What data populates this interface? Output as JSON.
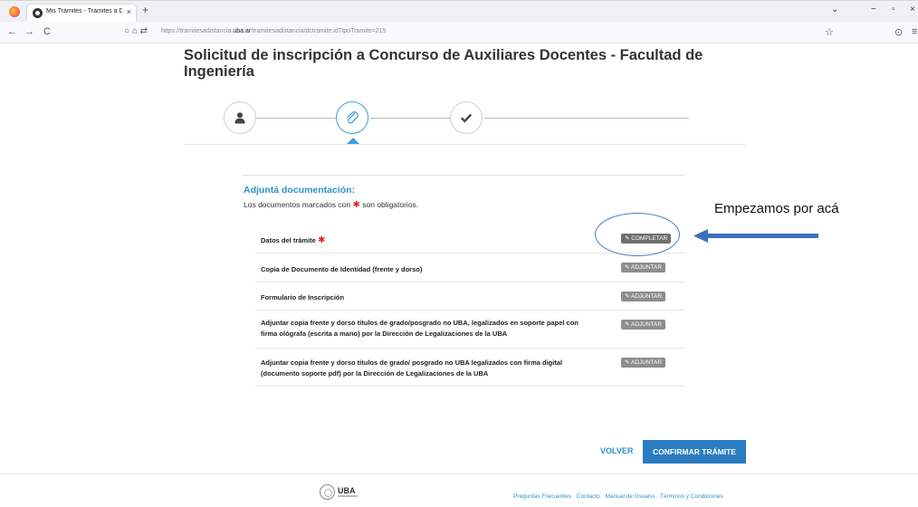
{
  "browser": {
    "tab_title": "Mis Trámites - Trámites a Dista",
    "tab_close": "×",
    "new_tab": "+",
    "url_prefix": "https://tramitesadistancia.",
    "url_domain": "uba.ar",
    "url_suffix": "/tramitesadistancia/dctramite:idTipoTramite=215",
    "nav_back": "←",
    "nav_forward": "→",
    "nav_reload": "C",
    "url_icons": "○ ⌂ ⇄",
    "bookmark": "☆",
    "pocket": "⊙",
    "menu": "≡",
    "win_list": "⌄",
    "win_min": "−",
    "win_max": "▫",
    "win_close": "×"
  },
  "page": {
    "title": "Solicitud de inscripción a Concurso de Auxiliares Docentes - Facultad de Ingeniería"
  },
  "stepper": {
    "steps": [
      {
        "icon": "user-icon",
        "active": false
      },
      {
        "icon": "paperclip-icon",
        "active": true
      },
      {
        "icon": "check-icon",
        "active": false
      }
    ]
  },
  "documents": {
    "heading": "Adjuntá documentación:",
    "note_before": "Los documentos marcados con",
    "note_star": "✱",
    "note_after": "son obligatorios.",
    "items": [
      {
        "label": "Datos del trámite",
        "required": "✱",
        "button": "✎ COMPLETAR"
      },
      {
        "label": "Copia de Documento de Identidad (frente y dorso)",
        "button": "✎ ADJUNTAR"
      },
      {
        "label": "Formulario de Inscripción",
        "button": "✎ ADJUNTAR"
      },
      {
        "label": "Adjuntar copia frente y dorso títulos de grado/posgrado no UBA, legalizados en soporte papel con firma ológrafa (escrita a mano) por la Dirección de Legalizaciones de la UBA",
        "button": "✎ ADJUNTAR"
      },
      {
        "label": "Adjuntar copia frente y dorso títulos de grado/ posgrado no UBA legalizados con firma digital (documento soporte pdf) por la Dirección de Legalizaciones de la UBA",
        "button": "✎ ADJUNTAR"
      }
    ]
  },
  "annotation": {
    "text": "Empezamos por acá",
    "arrow_color": "#3d6fc0",
    "ellipse_color": "#4a78c2"
  },
  "actions": {
    "back": "VOLVER",
    "confirm": "CONFIRMAR TRÁMITE"
  },
  "footer": {
    "logo_text": "UBA",
    "links": [
      "Preguntas Frecuentes",
      "Contacto",
      "Manual de Usuario",
      "Términos y Condiciones"
    ]
  },
  "colors": {
    "accent": "#2e92c9",
    "primary_button": "#2b7cc2",
    "required": "#e0242c"
  }
}
